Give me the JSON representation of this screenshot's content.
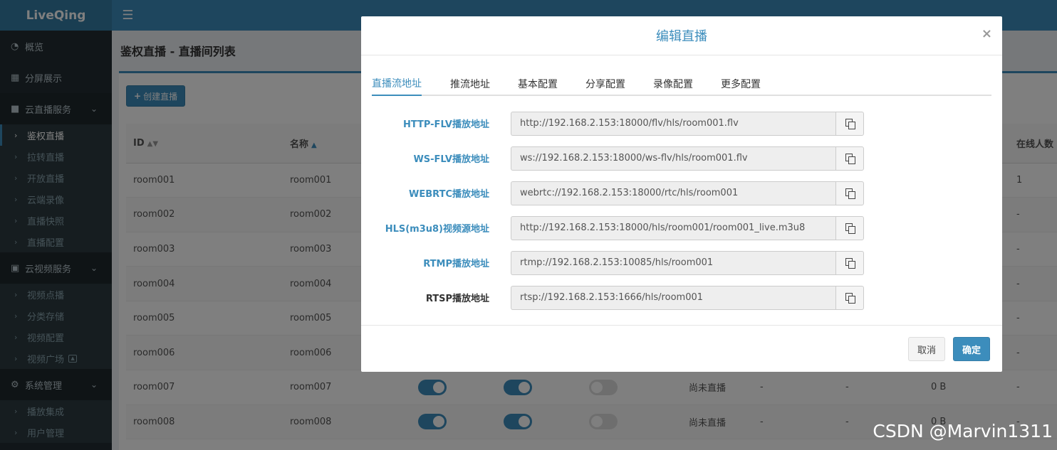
{
  "brand": "LiveQing",
  "sidebar": {
    "overview": "概览",
    "split_screen": "分屏展示",
    "cloud_live": {
      "label": "云直播服务",
      "items": [
        "鉴权直播",
        "拉转直播",
        "开放直播",
        "云端录像",
        "直播快照",
        "直播配置"
      ]
    },
    "cloud_video": {
      "label": "云视频服务",
      "items": [
        "视频点播",
        "分类存储",
        "视频配置",
        "视频广场"
      ]
    },
    "system": {
      "label": "系统管理",
      "items": [
        "播放集成",
        "用户管理"
      ]
    }
  },
  "page": {
    "title": "鉴权直播 - 直播间列表",
    "create_button": "创建直播",
    "table": {
      "headers": {
        "id": "ID",
        "name": "名称",
        "online": "在线人数"
      },
      "rows": [
        {
          "id": "room001",
          "name": "room001",
          "online": "1"
        },
        {
          "id": "room002",
          "name": "room002",
          "online": "-"
        },
        {
          "id": "room003",
          "name": "room003",
          "online": "-"
        },
        {
          "id": "room004",
          "name": "room004",
          "online": "-"
        },
        {
          "id": "room005",
          "name": "room005",
          "online": "-"
        },
        {
          "id": "room006",
          "name": "room006",
          "online": "-"
        },
        {
          "id": "room007",
          "name": "room007",
          "status": "尚未直播",
          "c1": "-",
          "c2": "-",
          "size": "0 B",
          "online": "-"
        },
        {
          "id": "room008",
          "name": "room008",
          "status": "尚未直播",
          "c1": "-",
          "c2": "-",
          "size": "0 B",
          "online": "-"
        }
      ]
    }
  },
  "modal": {
    "title": "编辑直播",
    "close": "×",
    "tabs": [
      "直播流地址",
      "推流地址",
      "基本配置",
      "分享配置",
      "录像配置",
      "更多配置"
    ],
    "streams": [
      {
        "label": "HTTP-FLV播放地址",
        "url": "http://192.168.2.153:18000/flv/hls/room001.flv"
      },
      {
        "label": "WS-FLV播放地址",
        "url": "ws://192.168.2.153:18000/ws-flv/hls/room001.flv"
      },
      {
        "label": "WEBRTC播放地址",
        "url": "webrtc://192.168.2.153:18000/rtc/hls/room001"
      },
      {
        "label": "HLS(m3u8)视频源地址",
        "url": "http://192.168.2.153:18000/hls/room001/room001_live.m3u8"
      },
      {
        "label": "RTMP播放地址",
        "url": "rtmp://192.168.2.153:10085/hls/room001"
      },
      {
        "label": "RTSP播放地址",
        "url": "rtsp://192.168.2.153:1666/hls/room001"
      }
    ],
    "cancel": "取消",
    "ok": "确定"
  },
  "watermark": "CSDN @Marvin1311"
}
